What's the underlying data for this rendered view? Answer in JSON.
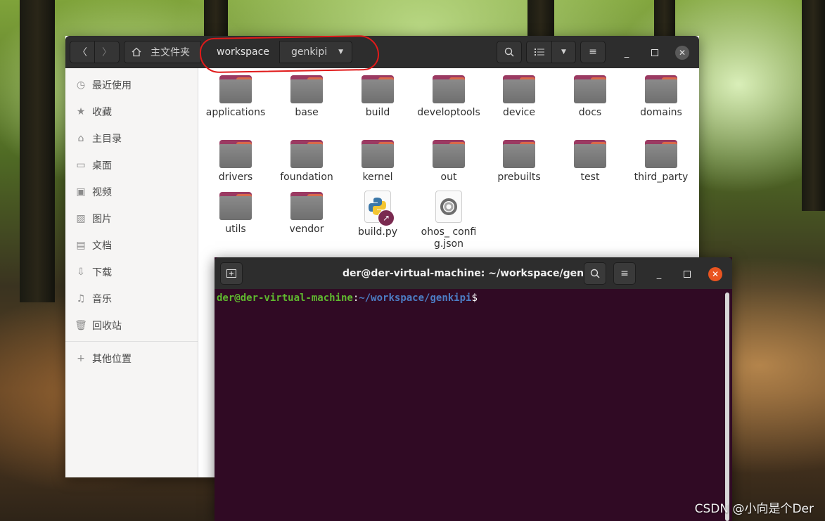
{
  "files_window": {
    "breadcrumb": {
      "home_label": "主文件夹",
      "segments": [
        "workspace",
        "genkipi"
      ]
    },
    "sidebar": [
      {
        "label": "最近使用",
        "icon": "clock-icon"
      },
      {
        "label": "收藏",
        "icon": "star-icon"
      },
      {
        "label": "主目录",
        "icon": "home-icon"
      },
      {
        "label": "桌面",
        "icon": "desktop-icon"
      },
      {
        "label": "视频",
        "icon": "video-icon"
      },
      {
        "label": "图片",
        "icon": "image-icon"
      },
      {
        "label": "文档",
        "icon": "document-icon"
      },
      {
        "label": "下载",
        "icon": "download-icon"
      },
      {
        "label": "音乐",
        "icon": "music-icon"
      },
      {
        "label": "回收站",
        "icon": "trash-icon"
      }
    ],
    "other_locations": {
      "label": "其他位置",
      "icon": "plus-icon"
    },
    "items": [
      {
        "name": "applications",
        "type": "folder"
      },
      {
        "name": "base",
        "type": "folder"
      },
      {
        "name": "build",
        "type": "folder"
      },
      {
        "name": "developtools",
        "type": "folder"
      },
      {
        "name": "device",
        "type": "folder"
      },
      {
        "name": "docs",
        "type": "folder"
      },
      {
        "name": "domains",
        "type": "folder"
      },
      {
        "name": "drivers",
        "type": "folder"
      },
      {
        "name": "foundation",
        "type": "folder"
      },
      {
        "name": "kernel",
        "type": "folder"
      },
      {
        "name": "out",
        "type": "folder"
      },
      {
        "name": "prebuilts",
        "type": "folder"
      },
      {
        "name": "test",
        "type": "folder"
      },
      {
        "name": "third_party",
        "type": "folder"
      },
      {
        "name": "utils",
        "type": "folder"
      },
      {
        "name": "vendor",
        "type": "folder"
      },
      {
        "name": "build.py",
        "type": "python-symlink"
      },
      {
        "name": "ohos_ config.json",
        "type": "json"
      }
    ]
  },
  "terminal": {
    "title": "der@der-virtual-machine: ~/workspace/genkipi",
    "prompt_user": "der@der-virtual-machine",
    "prompt_colon": ":",
    "prompt_path": "~/workspace/genkipi",
    "prompt_symbol": "$"
  },
  "watermark": "CSDN @小向是个Der",
  "colors": {
    "terminal_bg": "#300a24",
    "prompt_user": "#5fb72f",
    "prompt_path": "#4c7dc4",
    "folder_tab": "#9b3a62",
    "annotation": "#e01a1a"
  }
}
